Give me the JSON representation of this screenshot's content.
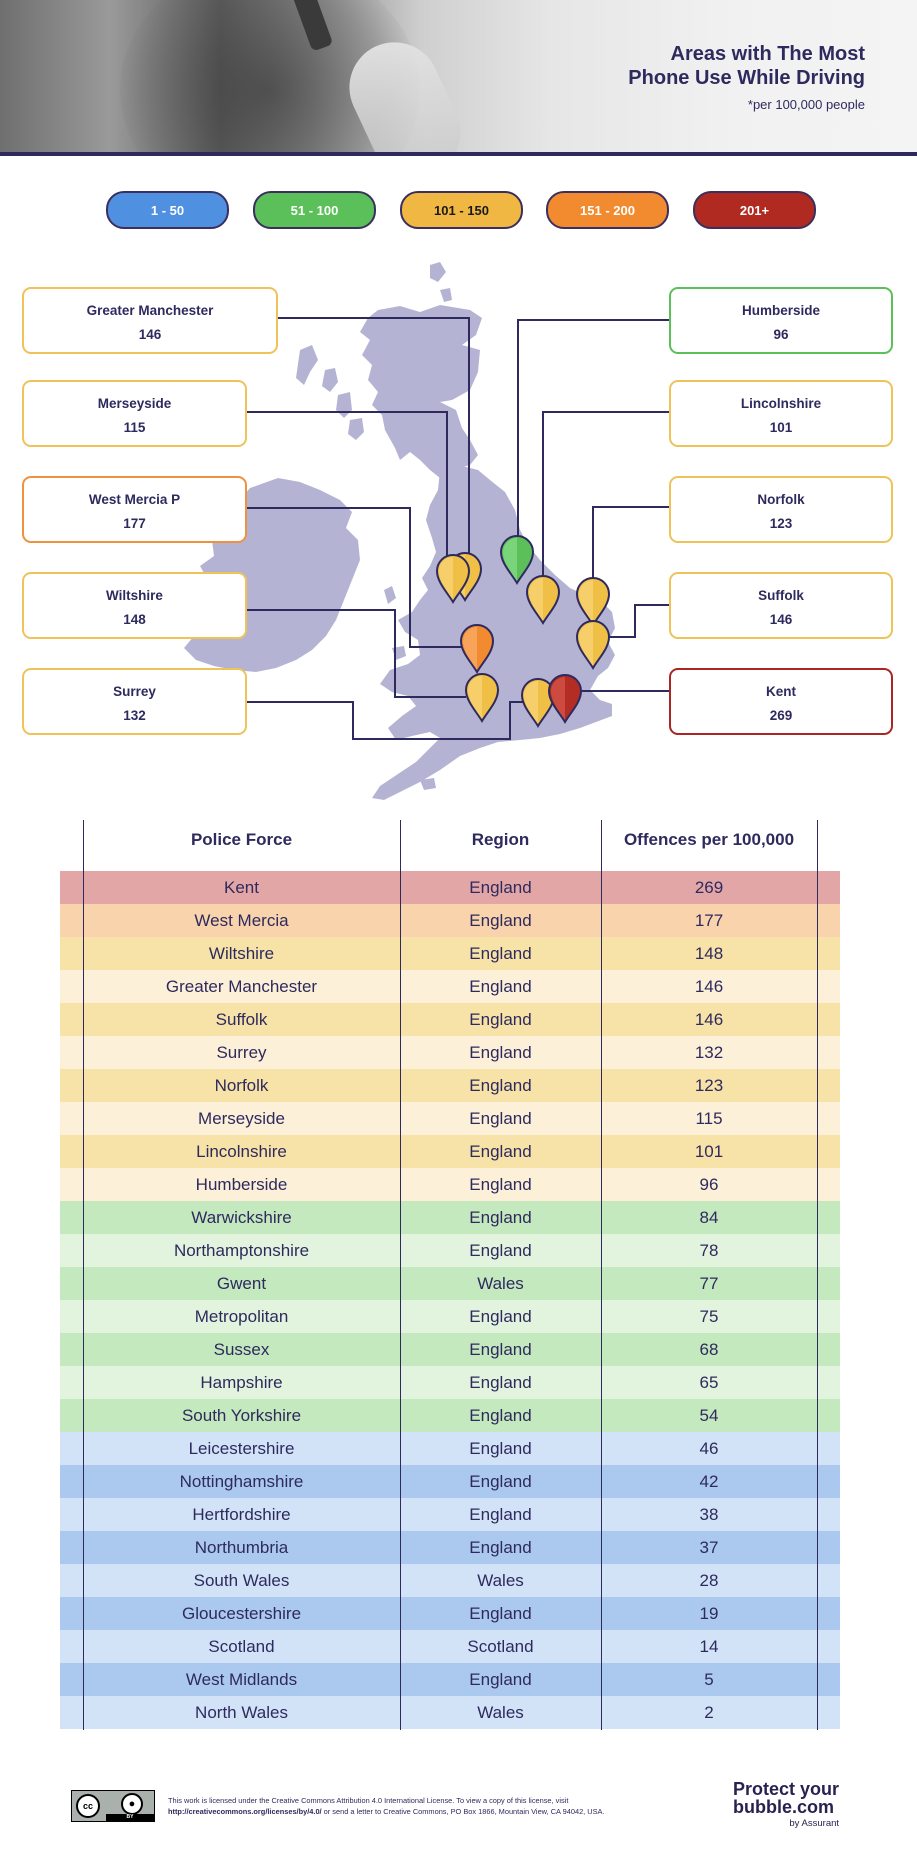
{
  "header": {
    "title_line1": "Areas with The Most",
    "title_line2": "Phone Use While Driving",
    "subtitle": "*per 100,000 people"
  },
  "legend": [
    {
      "label": "1 - 50",
      "color": "#4f90e0",
      "text_color": "#ffffff"
    },
    {
      "label": "51 - 100",
      "color": "#5cc05a",
      "text_color": "#ffffff"
    },
    {
      "label": "101 - 150",
      "color": "#f0b843",
      "text_color": "#1a1a1a"
    },
    {
      "label": "151 - 200",
      "color": "#f28b30",
      "text_color": "#ffffff"
    },
    {
      "label": "201+",
      "color": "#b02a22",
      "text_color": "#ffffff"
    }
  ],
  "map": {
    "land_color": "#b5b3d4",
    "line_color": "#2e2a5e",
    "labels": [
      {
        "name": "Greater Manchester",
        "value": "146",
        "band": 2,
        "side": "left"
      },
      {
        "name": "Merseyside",
        "value": "115",
        "band": 2,
        "side": "left"
      },
      {
        "name": "West Mercia P",
        "value": "177",
        "band": 3,
        "side": "left"
      },
      {
        "name": "Wiltshire",
        "value": "148",
        "band": 2,
        "side": "left"
      },
      {
        "name": "Surrey",
        "value": "132",
        "band": 2,
        "side": "left"
      },
      {
        "name": "Humberside",
        "value": "96",
        "band": 1,
        "side": "right"
      },
      {
        "name": "Lincolnshire",
        "value": "101",
        "band": 2,
        "side": "right"
      },
      {
        "name": "Norfolk",
        "value": "123",
        "band": 2,
        "side": "right"
      },
      {
        "name": "Suffolk",
        "value": "146",
        "band": 2,
        "side": "right"
      },
      {
        "name": "Kent",
        "value": "269",
        "band": 4,
        "side": "right"
      }
    ],
    "band_border_colors": [
      "#4f90e0",
      "#5cc05a",
      "#efc35a",
      "#ee9240",
      "#ab2622"
    ]
  },
  "table": {
    "headers": [
      "Police Force",
      "Region",
      "Offences per 100,000"
    ],
    "rows": [
      {
        "force": "Kent",
        "region": "England",
        "value": "269",
        "bg": "#e3a6a6"
      },
      {
        "force": "West Mercia",
        "region": "England",
        "value": "177",
        "bg": "#f9d3ab"
      },
      {
        "force": "Wiltshire",
        "region": "England",
        "value": "148",
        "bg": "#f7e3a8"
      },
      {
        "force": "Greater Manchester",
        "region": "England",
        "value": "146",
        "bg": "#fcf0d8"
      },
      {
        "force": "Suffolk",
        "region": "England",
        "value": "146",
        "bg": "#f7e3a8"
      },
      {
        "force": "Surrey",
        "region": "England",
        "value": "132",
        "bg": "#fcf0d8"
      },
      {
        "force": "Norfolk",
        "region": "England",
        "value": "123",
        "bg": "#f7e3a8"
      },
      {
        "force": "Merseyside",
        "region": "England",
        "value": "115",
        "bg": "#fcf0d8"
      },
      {
        "force": "Lincolnshire",
        "region": "England",
        "value": "101",
        "bg": "#f7e3a8"
      },
      {
        "force": "Humberside",
        "region": "England",
        "value": "96",
        "bg": "#fcf0d8"
      },
      {
        "force": "Warwickshire",
        "region": "England",
        "value": "84",
        "bg": "#c5e9be"
      },
      {
        "force": "Northamptonshire",
        "region": "England",
        "value": "78",
        "bg": "#e3f4de"
      },
      {
        "force": "Gwent",
        "region": "Wales",
        "value": "77",
        "bg": "#c5e9be"
      },
      {
        "force": "Metropolitan",
        "region": "England",
        "value": "75",
        "bg": "#e3f4de"
      },
      {
        "force": "Sussex",
        "region": "England",
        "value": "68",
        "bg": "#c5e9be"
      },
      {
        "force": "Hampshire",
        "region": "England",
        "value": "65",
        "bg": "#e3f4de"
      },
      {
        "force": "South Yorkshire",
        "region": "England",
        "value": "54",
        "bg": "#c5e9be"
      },
      {
        "force": "Leicestershire",
        "region": "England",
        "value": "46",
        "bg": "#d3e3f7"
      },
      {
        "force": "Nottinghamshire",
        "region": "England",
        "value": "42",
        "bg": "#abc9ee"
      },
      {
        "force": "Hertfordshire",
        "region": "England",
        "value": "38",
        "bg": "#d3e3f7"
      },
      {
        "force": "Northumbria",
        "region": "England",
        "value": "37",
        "bg": "#abc9ee"
      },
      {
        "force": "South Wales",
        "region": "Wales",
        "value": "28",
        "bg": "#d3e3f7"
      },
      {
        "force": "Gloucestershire",
        "region": "England",
        "value": "19",
        "bg": "#abc9ee"
      },
      {
        "force": "Scotland",
        "region": "Scotland",
        "value": "14",
        "bg": "#d3e3f7"
      },
      {
        "force": "West Midlands",
        "region": "England",
        "value": "5",
        "bg": "#abc9ee"
      },
      {
        "force": "North Wales",
        "region": "Wales",
        "value": "2",
        "bg": "#d3e3f7"
      }
    ]
  },
  "footer": {
    "cc_label": "cc",
    "by_label": "BY",
    "license_line1": "This work is licensed under the Creative Commons Attribution 4.0 International License. To view a copy of this license, visit",
    "license_url": "http://creativecommons.org/licenses/by/4.0/",
    "license_line2_rest": " or send a letter to Creative Commons, PO Box 1866, Mountain View, CA 94042, USA.",
    "brand_line1": "Protect your",
    "brand_line2": "bubble.com",
    "brand_by": "by Assurant"
  }
}
